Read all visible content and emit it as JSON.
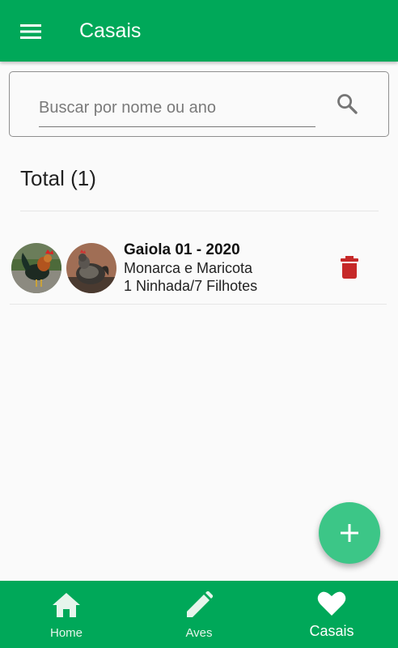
{
  "appbar": {
    "title": "Casais"
  },
  "search": {
    "placeholder": "Buscar por nome ou ano",
    "value": ""
  },
  "summary": {
    "total": "Total (1)"
  },
  "pairs": [
    {
      "title": "Gaiola 01 - 2020",
      "names": "Monarca e Maricota",
      "stats": "1 Ninhada/7 Filhotes"
    }
  ],
  "bottom_nav": {
    "items": [
      {
        "label": "Home",
        "icon": "home-icon"
      },
      {
        "label": "Aves",
        "icon": "pencil-icon"
      },
      {
        "label": "Casais",
        "icon": "heart-icon",
        "active": true
      }
    ]
  },
  "colors": {
    "primary": "#00a859",
    "fab": "#3cc687",
    "delete": "#c62828"
  }
}
